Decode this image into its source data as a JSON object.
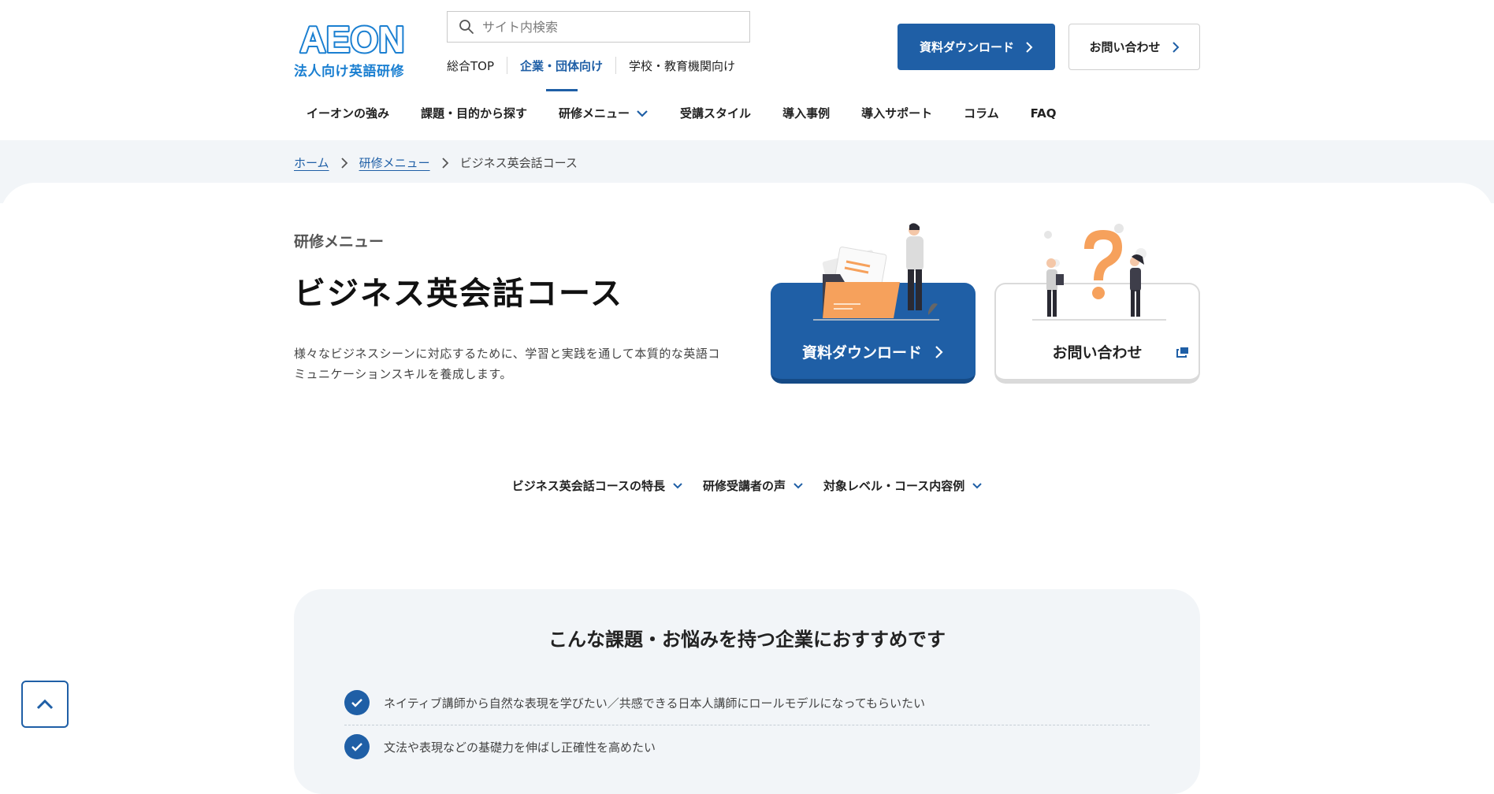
{
  "header": {
    "logo_text": "AEON",
    "logo_sub": "法人向け英語研修",
    "search_placeholder": "サイト内検索",
    "subnav": [
      "総合TOP",
      "企業・団体向け",
      "学校・教育機関向け"
    ],
    "download_label": "資料ダウンロード",
    "contact_label": "お問い合わせ"
  },
  "mainnav": [
    "イーオンの強み",
    "課題・目的から探す",
    "研修メニュー",
    "受講スタイル",
    "導入事例",
    "導入サポート",
    "コラム",
    "FAQ"
  ],
  "breadcrumb": {
    "home": "ホーム",
    "parent": "研修メニュー",
    "current": "ビジネス英会話コース"
  },
  "hero": {
    "kicker": "研修メニュー",
    "title": "ビジネス英会話コース",
    "desc_line1": "様々なビジネスシーンに対応するために、学習と実践を通して本質的な英語コ",
    "desc_line2": "ミュニケーションスキルを養成します。",
    "cta_download": "資料ダウンロード",
    "cta_contact": "お問い合わせ"
  },
  "anchors": [
    "ビジネス英会話コースの特長",
    "研修受講者の声",
    "対象レベル・コース内容例"
  ],
  "recommend": {
    "title": "こんな課題・お悩みを持つ企業におすすめです",
    "items": [
      "ネイティブ講師から自然な表現を学びたい／共感できる日本人講師にロールモデルになってもらいたい",
      "文法や表現などの基礎力を伸ばし正確性を高めたい"
    ]
  },
  "colors": {
    "primary": "#1f5fa6",
    "logo_blue": "#1a7fd1",
    "accent_orange": "#f6a15c",
    "band_bg": "#f2f5f8"
  },
  "icons": {
    "search": "search-icon",
    "chevron": "chevron-right-icon",
    "external": "external-window-icon",
    "check": "check-icon",
    "to_top": "chevron-up-icon"
  }
}
